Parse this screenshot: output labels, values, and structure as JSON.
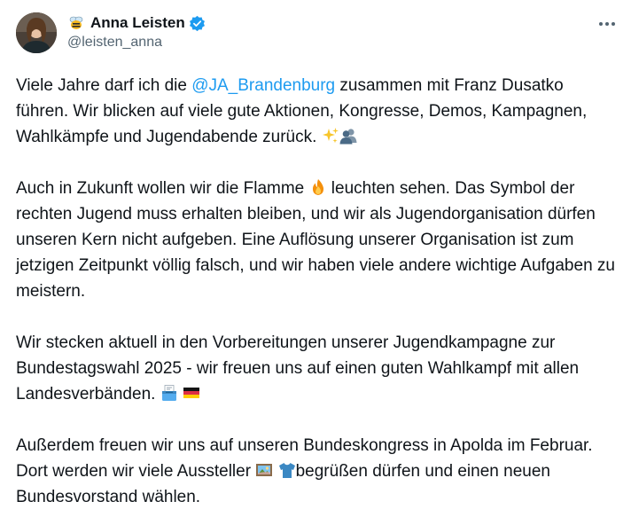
{
  "author": {
    "display_name": "Anna Leisten",
    "handle": "@leisten_anna"
  },
  "tweet": {
    "p1_before": "Viele Jahre darf ich die ",
    "p1_mention": "@JA_Brandenburg",
    "p1_after": " zusammen mit Franz Dusatko führen. Wir blicken auf viele gute Aktionen, Kongresse, Demos, Kampagnen, Wahlkämpfe und Jugendabende zurück. ",
    "p2_before": "Auch in Zukunft wollen wir die Flamme ",
    "p2_after": " leuchten sehen. Das Symbol der rechten Jugend muss erhalten bleiben, und wir als Jugendorganisation dürfen unseren Kern nicht aufgeben. Eine Auflösung unserer Organisation ist zum jetzigen Zeitpunkt völlig falsch, und wir haben viele andere wichtige Aufgaben zu meistern.",
    "p3_text": "Wir stecken aktuell in den Vorbereitungen unserer Jugendkampagne zur Bundestagswahl 2025 - wir freuen uns auf einen guten Wahlkampf mit allen Landesverbänden. ",
    "p4_before": "Außerdem freuen wir uns auf unseren Bundeskongress in Apolda im Februar. Dort werden wir viele Aussteller ",
    "p4_after": "begrüßen dürfen und einen neuen Bundesvorstand wählen."
  },
  "icons": {
    "bee": "bee-emoji",
    "verified": "verified-badge-icon",
    "more": "more-options-icon",
    "sparkles": "sparkles-emoji",
    "people": "busts-in-silhouette-emoji",
    "fire": "fire-emoji",
    "ballot": "ballot-box-emoji",
    "flag": "germany-flag-emoji",
    "picture": "framed-picture-emoji",
    "shirt": "t-shirt-emoji"
  },
  "colors": {
    "accent": "#1d9bf0",
    "text": "#0f1419",
    "secondary_text": "#536471"
  }
}
